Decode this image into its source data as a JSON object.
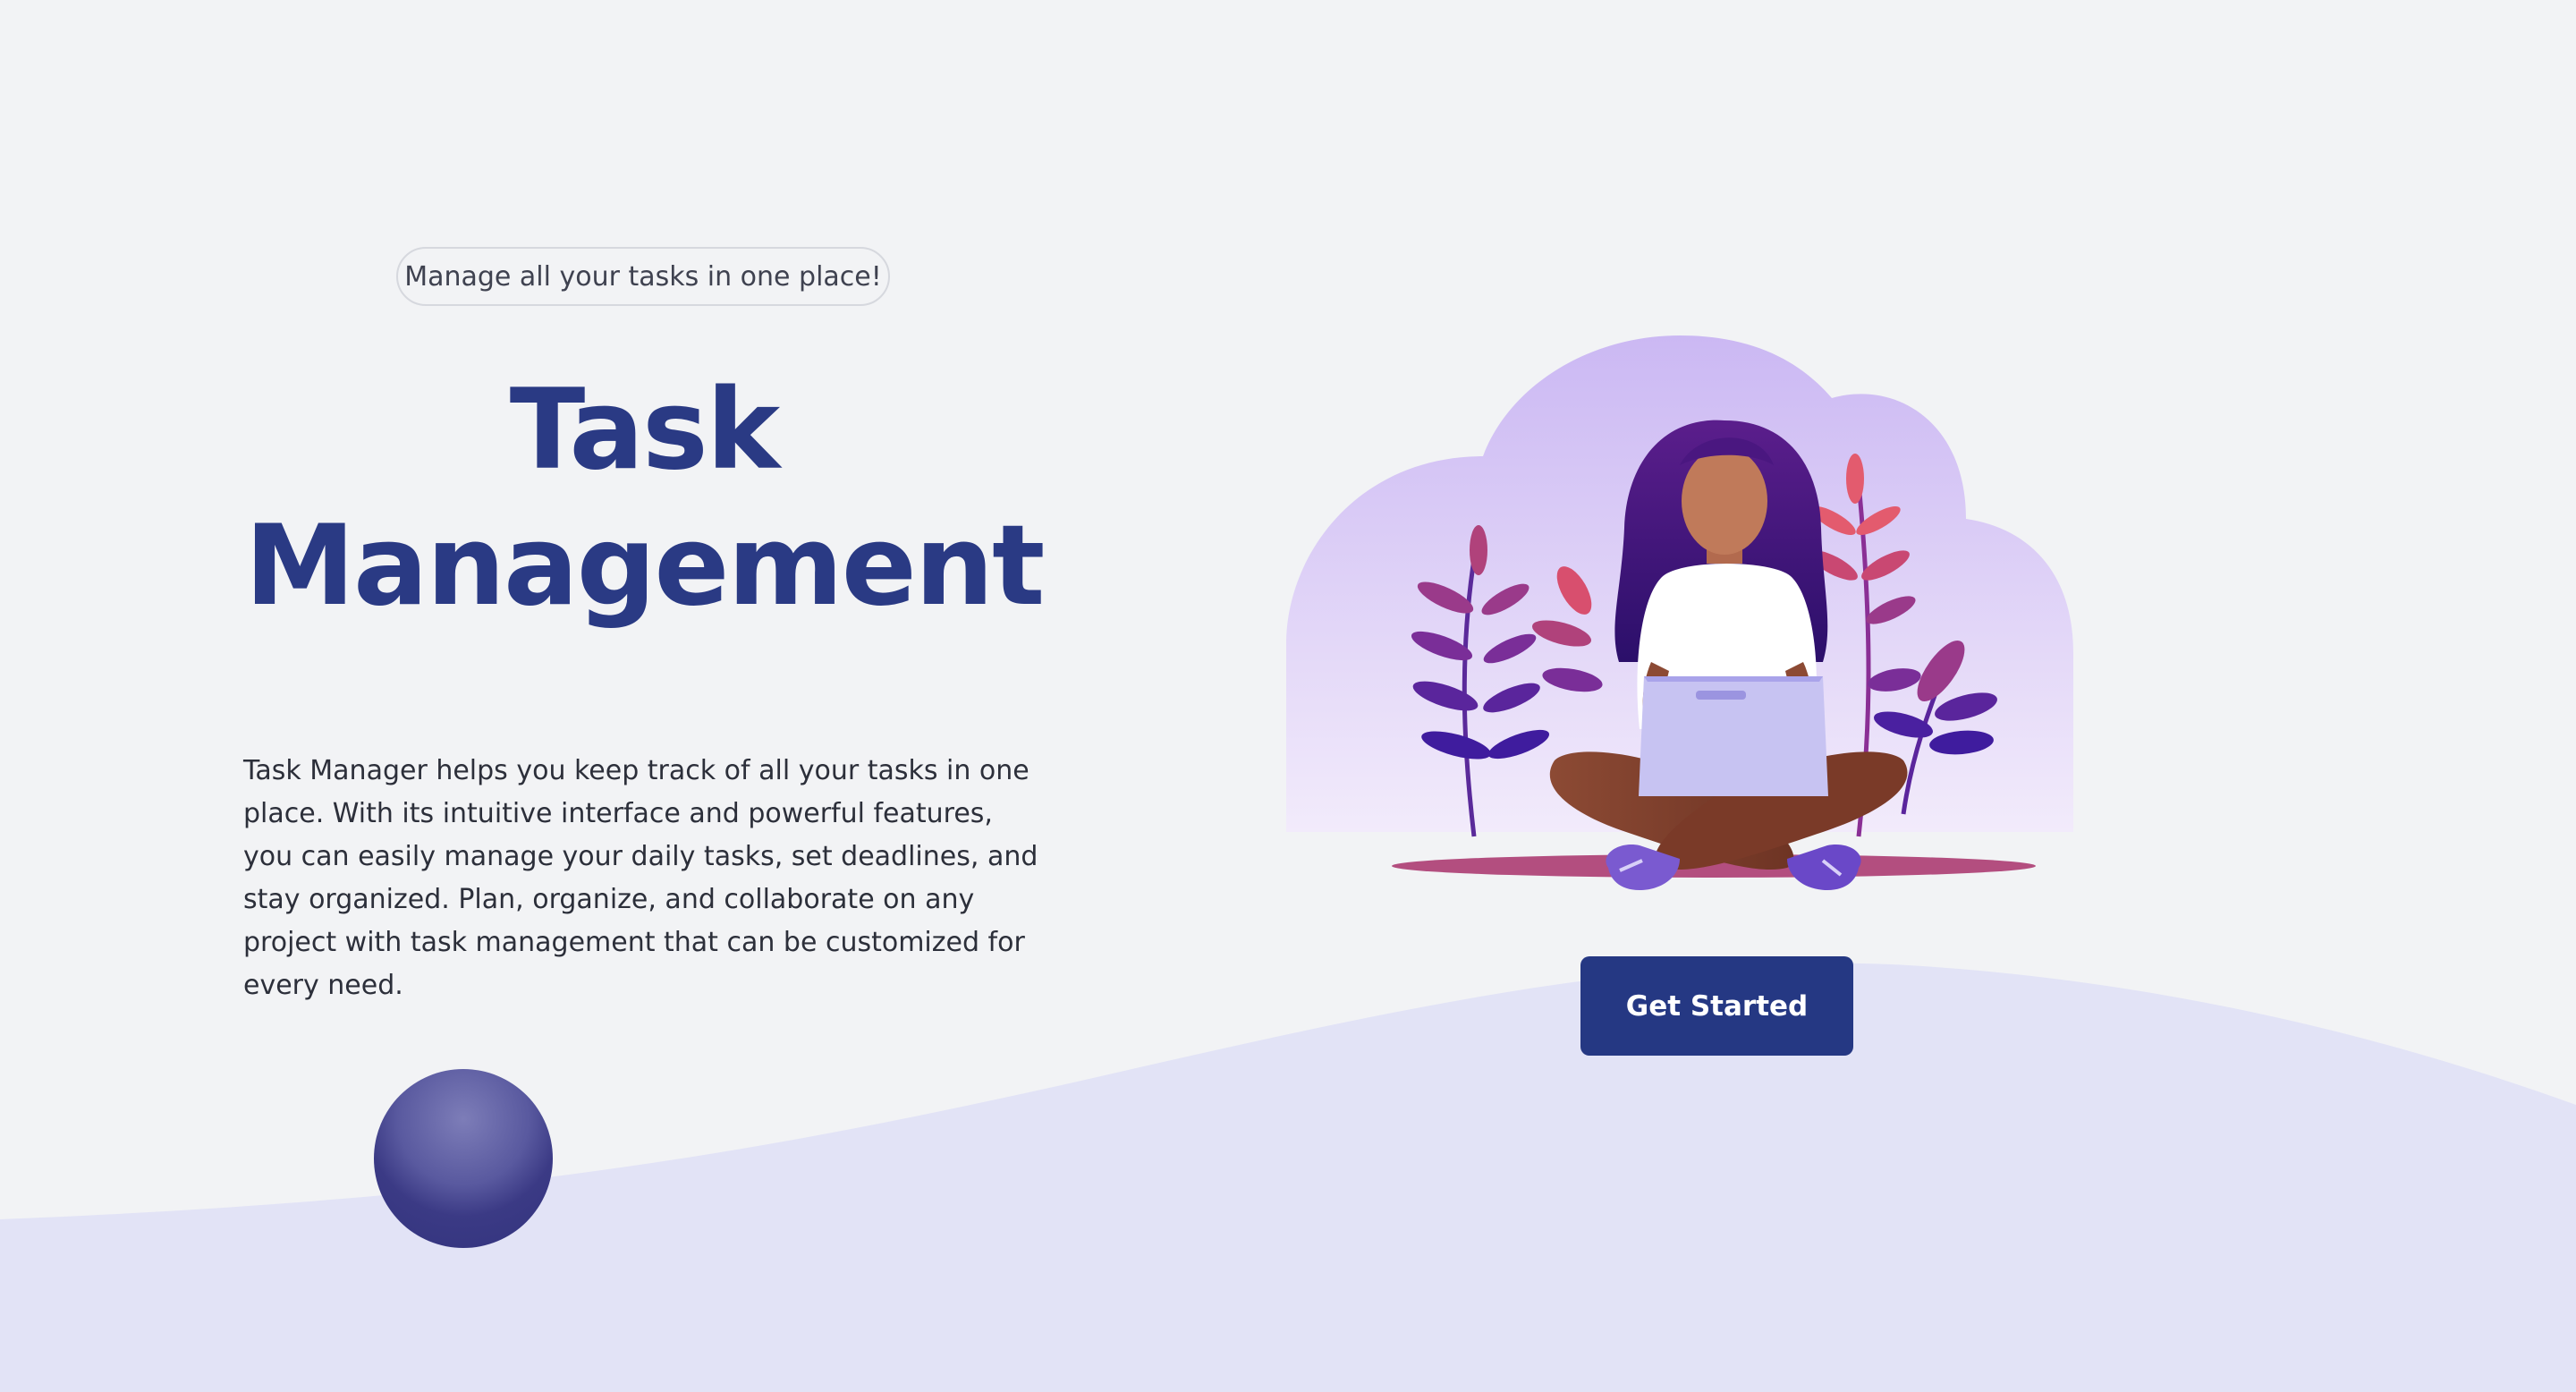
{
  "hero": {
    "tagline": "Manage all your tasks in one place!",
    "title_line1": "Task",
    "title_line2": "Management",
    "description": "Task Manager helps you keep track of all your tasks in one place. With its intuitive interface and powerful features, you can easily manage your daily tasks, set deadlines, and stay organized. Plan, organize, and collaborate on any project with task management that can be customized for every need.",
    "cta_label": "Get Started"
  },
  "colors": {
    "background": "#f2f3f5",
    "wave": "#e2e3f6",
    "title": "#2a3a84",
    "button": "#253883",
    "cloud_top": "#cbb8f3",
    "cloud_bottom": "#f2ebfb"
  },
  "illustration": {
    "subject": "woman-with-laptop-illustration"
  }
}
